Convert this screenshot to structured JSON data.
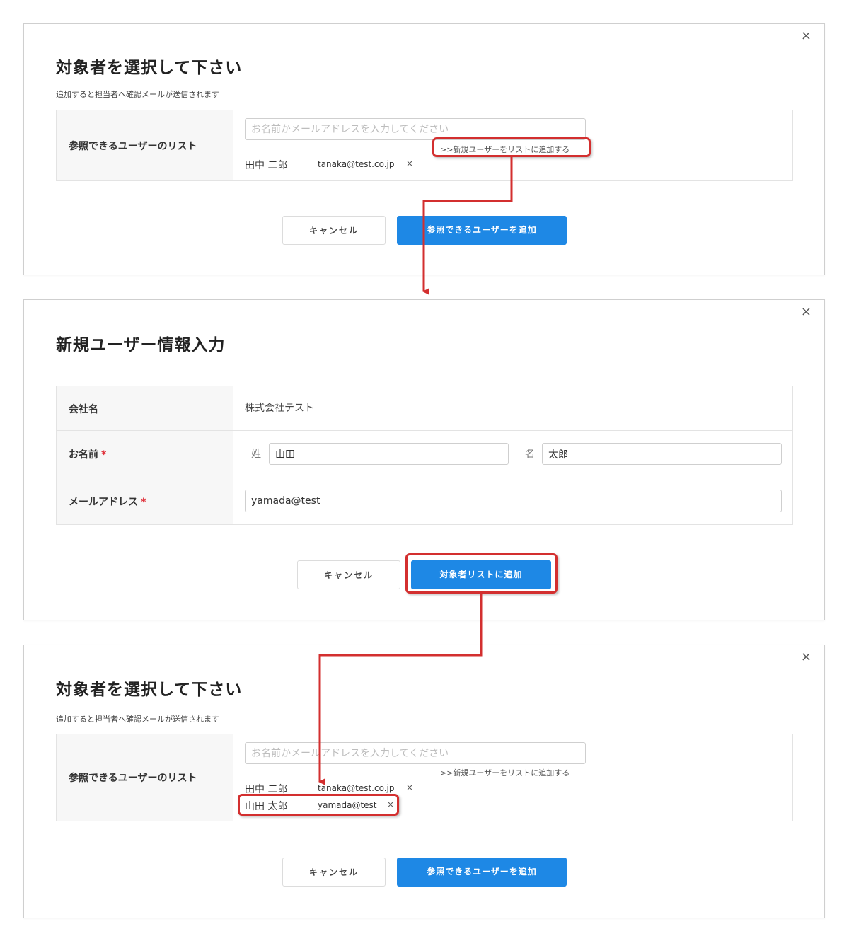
{
  "close_glyph": "×",
  "screen1": {
    "title": "対象者を選択して下さい",
    "subtitle": "追加すると担当者へ確認メールが送信されます",
    "list_label": "参照できるユーザーのリスト",
    "search_placeholder": "お名前かメールアドレスを入力してください",
    "add_new_link": ">>新規ユーザーをリストに追加する",
    "users": [
      {
        "name": "田中 二郎",
        "email": "tanaka@test.co.jp",
        "remove": "×"
      }
    ],
    "cancel_label": "キャンセル",
    "submit_label": "参照できるユーザーを追加"
  },
  "screen2": {
    "title": "新規ユーザー情報入力",
    "company_label": "会社名",
    "company_value": "株式会社テスト",
    "name_label": "お名前",
    "required_mark": "*",
    "last_name_label": "姓",
    "last_name_value": "山田",
    "first_name_label": "名",
    "first_name_value": "太郎",
    "email_label": "メールアドレス",
    "email_value": "yamada@test",
    "cancel_label": "キャンセル",
    "submit_label": "対象者リストに追加"
  },
  "screen3": {
    "title": "対象者を選択して下さい",
    "subtitle": "追加すると担当者へ確認メールが送信されます",
    "list_label": "参照できるユーザーのリスト",
    "search_placeholder": "お名前かメールアドレスを入力してください",
    "add_new_link": ">>新規ユーザーをリストに追加する",
    "users": [
      {
        "name": "田中 二郎",
        "email": "tanaka@test.co.jp",
        "remove": "×"
      },
      {
        "name": "山田 太郎",
        "email": "yamada@test",
        "remove": "×"
      }
    ],
    "cancel_label": "キャンセル",
    "submit_label": "参照できるユーザーを追加"
  },
  "colors": {
    "primary": "#1e88e5",
    "highlight": "#d32f2f",
    "required": "#e0303a"
  }
}
